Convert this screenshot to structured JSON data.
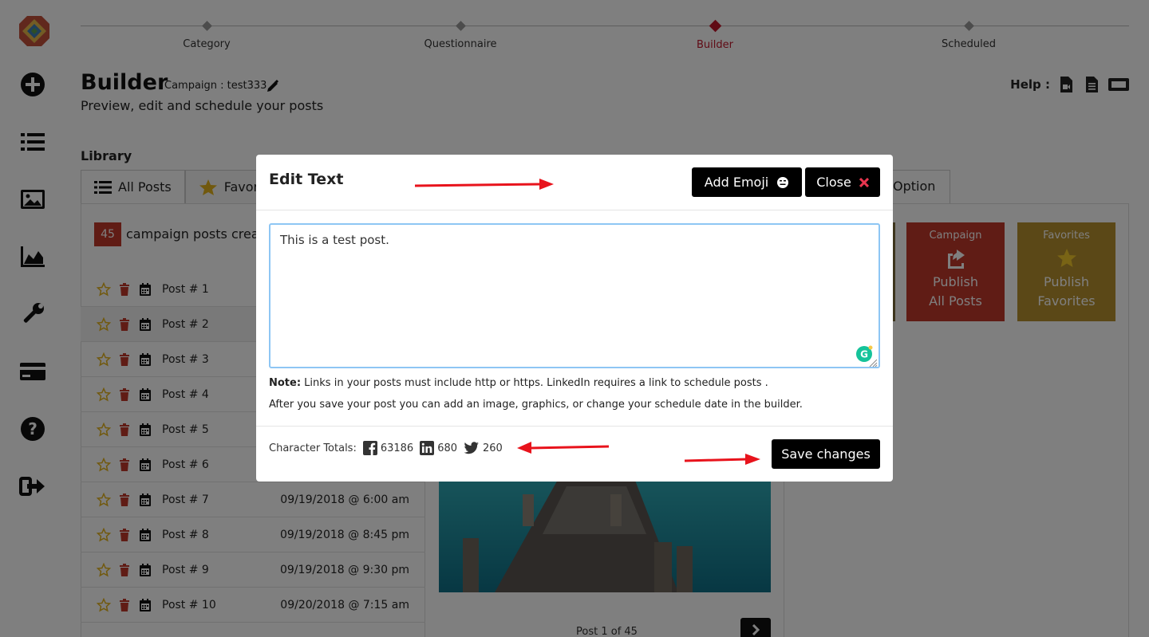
{
  "stepper": {
    "steps": [
      "Category",
      "Questionnaire",
      "Builder",
      "Scheduled"
    ],
    "active_index": 2
  },
  "header": {
    "title": "Builder",
    "campaign": "Campaign : test333",
    "subtitle": "Preview, edit and schedule your posts",
    "help_label": "Help :"
  },
  "library": {
    "section_label": "Library",
    "tab_all": "All Posts",
    "tab_fav": "Favor",
    "count": "45",
    "count_text": "campaign posts crea",
    "posts": [
      {
        "name": "Post # 1",
        "date": ""
      },
      {
        "name": "Post # 2",
        "date": ""
      },
      {
        "name": "Post # 3",
        "date": ""
      },
      {
        "name": "Post # 4",
        "date": ""
      },
      {
        "name": "Post # 5",
        "date": ""
      },
      {
        "name": "Post # 6",
        "date": ""
      },
      {
        "name": "Post # 7",
        "date": "09/19/2018 @ 6:00 am"
      },
      {
        "name": "Post # 8",
        "date": "09/19/2018 @ 8:45 pm"
      },
      {
        "name": "Post # 9",
        "date": "09/19/2018 @ 9:30 pm"
      },
      {
        "name": "Post # 10",
        "date": "09/20/2018 @ 7:15 am"
      }
    ]
  },
  "preview": {
    "pager_text": "Post 1 of 45"
  },
  "scheduler": {
    "option_tab": "Option",
    "cards": [
      {
        "top": "Campaign",
        "line1": "Publish",
        "line2": "All Posts",
        "color": "#c0392b"
      },
      {
        "top": "Favorites",
        "line1": "Publish",
        "line2": "Favorites",
        "color": "#b7902f"
      }
    ]
  },
  "modal": {
    "title": "Edit Text",
    "add_emoji_label": "Add Emoji",
    "close_label": "Close",
    "text_value": "This is a test post.",
    "note_bold": "Note:",
    "note_text": " Links in your posts must include http or https. LinkedIn requires a link to schedule posts .",
    "note2": "After you save your post you can add an image, graphics, or change your schedule date in the builder.",
    "char_totals_label": "Character Totals:",
    "facebook_count": "63186",
    "linkedin_count": "680",
    "twitter_count": "260",
    "save_label": "Save changes"
  },
  "colors": {
    "accent_red": "#c0172b",
    "focus_border": "#8ec6f4",
    "button_dark": "#000000"
  }
}
